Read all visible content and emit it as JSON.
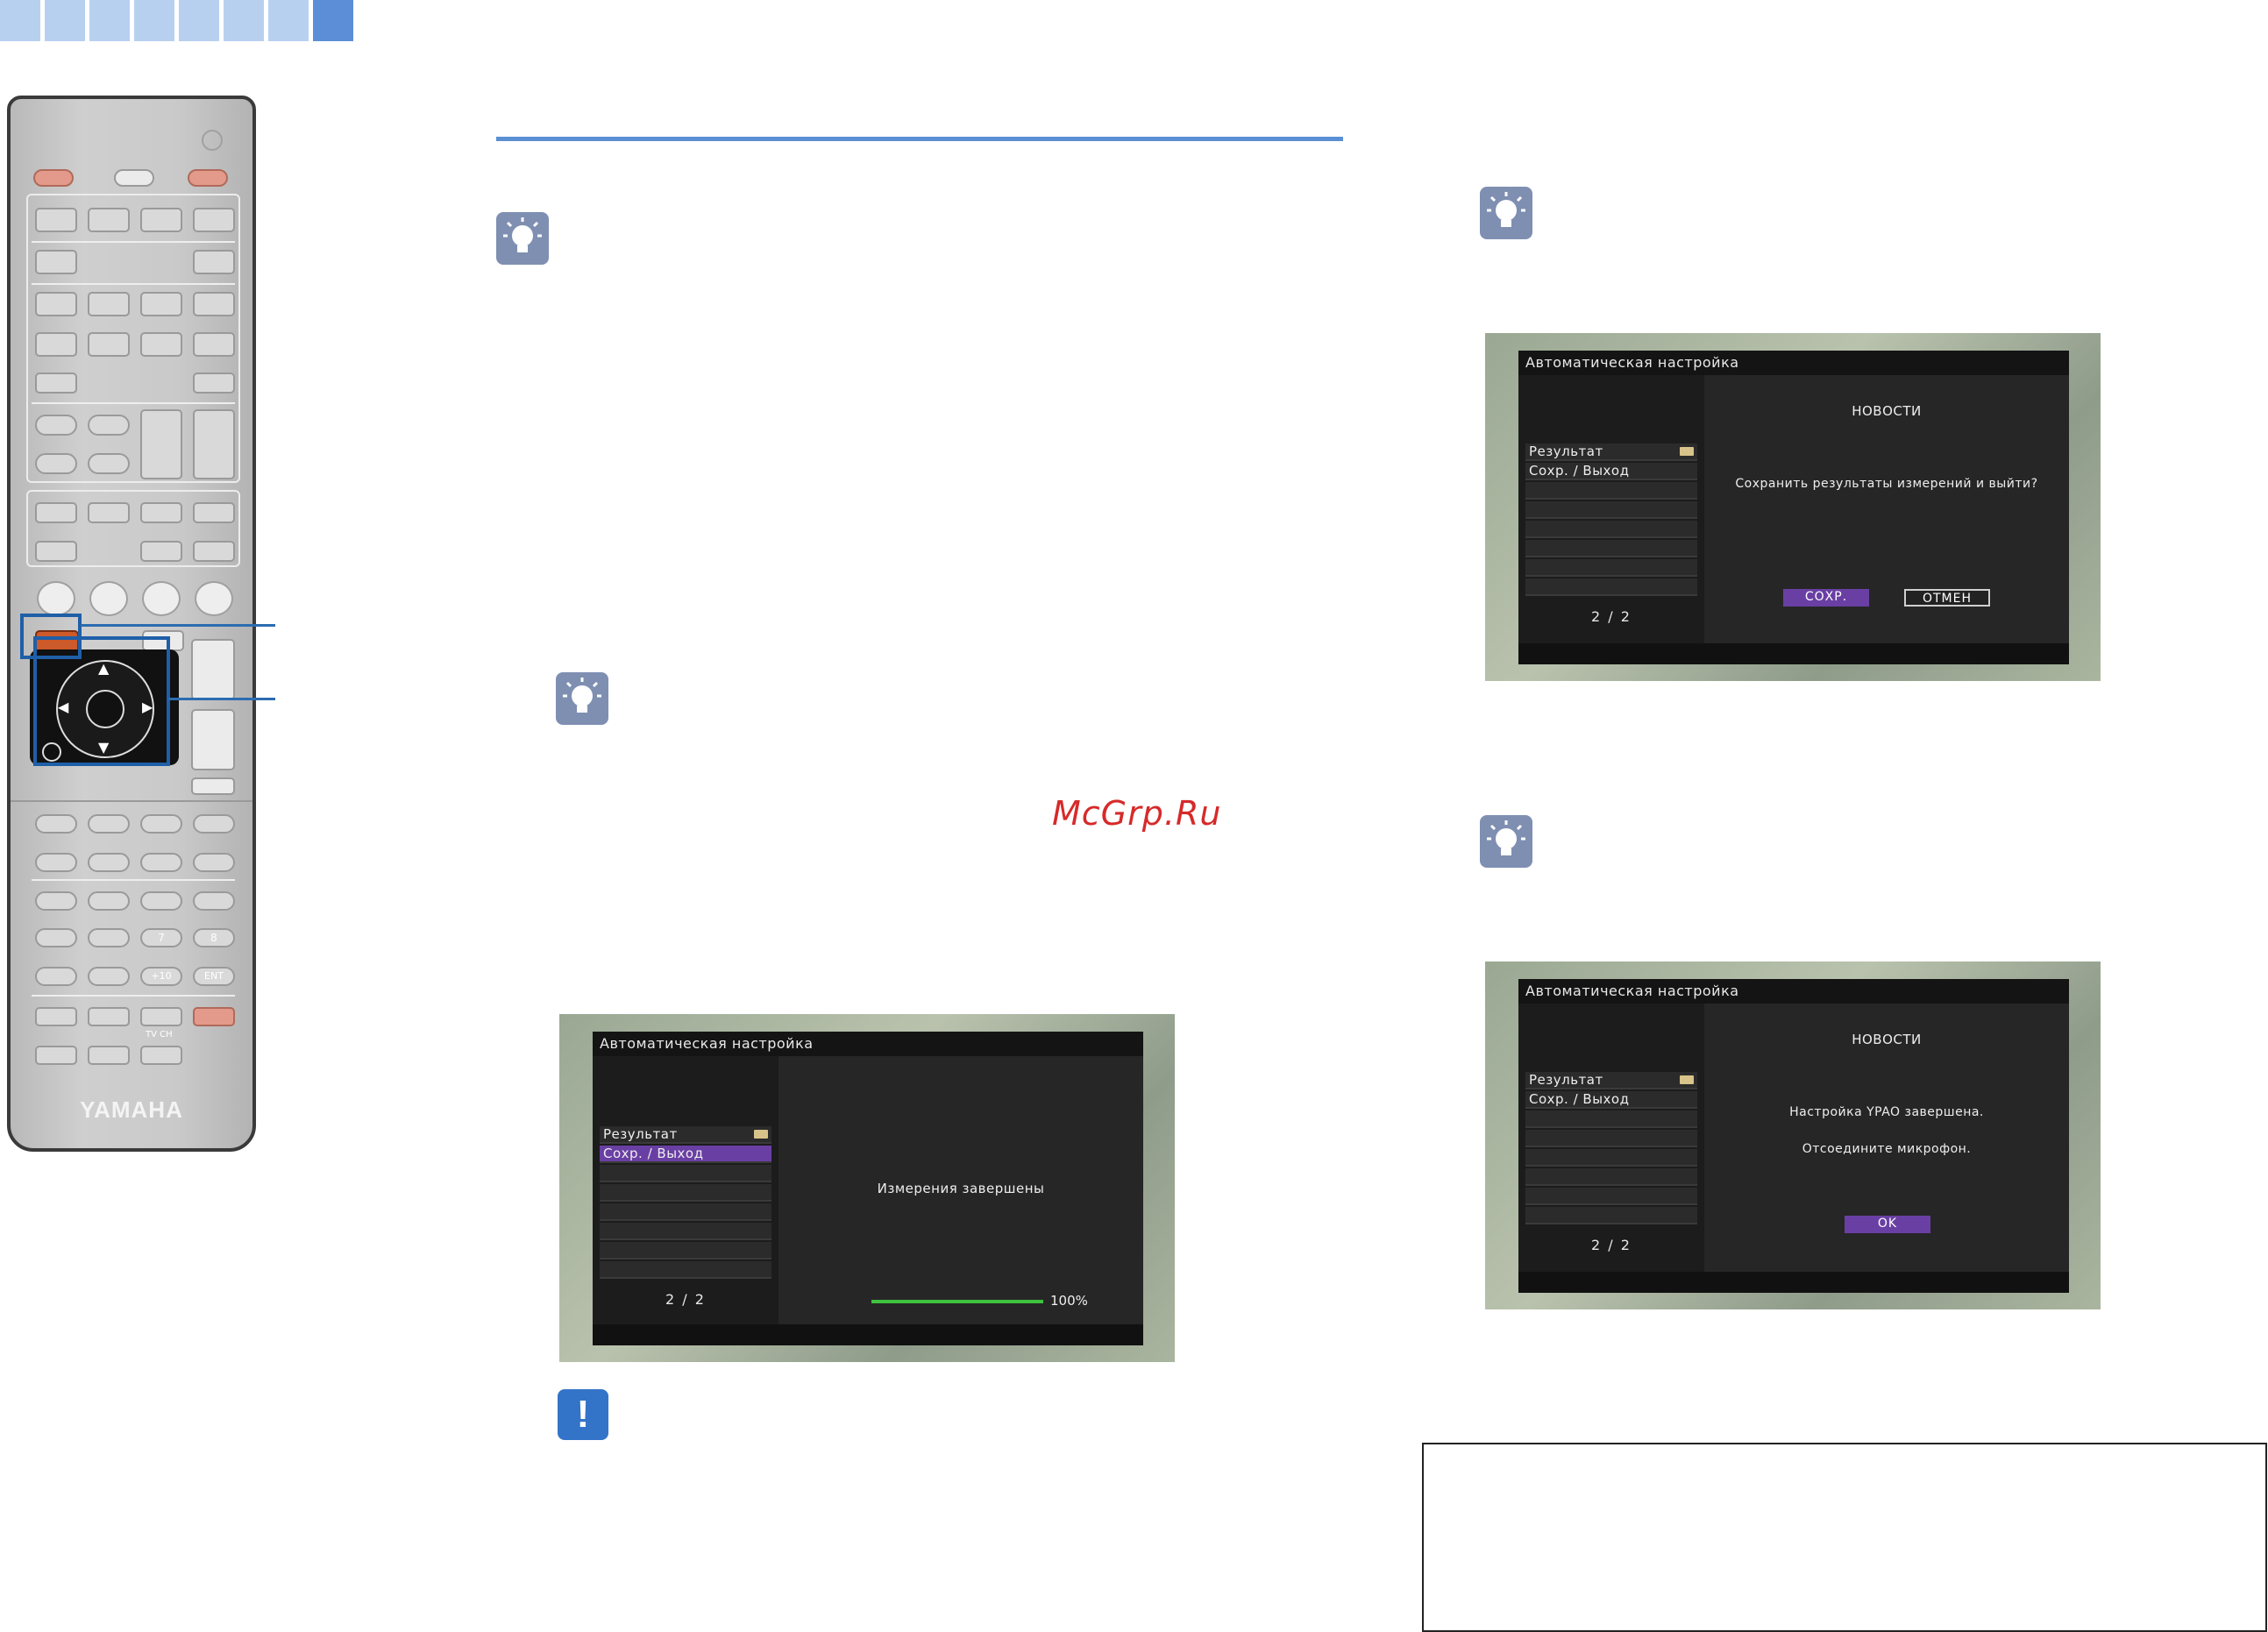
{
  "header_tabs": {
    "colors": [
      "#b8d0f0",
      "#b8d0f0",
      "#b8d0f0",
      "#b8d0f0",
      "#b8d0f0",
      "#b8d0f0",
      "#b8d0f0",
      "#5b8ed6"
    ]
  },
  "remote": {
    "brand": "YAMAHA",
    "keys": [
      "7",
      "8",
      "+10",
      "ENT",
      "TV CH"
    ]
  },
  "watermark": "McGrp.Ru",
  "screen1": {
    "title": "Автоматическая настройка",
    "menu": [
      "Результат",
      "Сохр. / Выход"
    ],
    "selected_index": 1,
    "page": "2 / 2",
    "message": "Измерения завершены",
    "progress_label": "100%",
    "progress_value": 1.0
  },
  "screen2": {
    "title": "Автоматическая настройка",
    "menu": [
      "Результат",
      "Сохр. / Выход"
    ],
    "page": "2 / 2",
    "heading": "НОВОСТИ",
    "message": "Сохранить результаты измерений и выйти?",
    "btn_save": "СОХР.",
    "btn_cancel": "ОТМЕН"
  },
  "screen3": {
    "title": "Автоматическая настройка",
    "menu": [
      "Результат",
      "Сохр. / Выход"
    ],
    "page": "2 / 2",
    "heading": "НОВОСТИ",
    "message_line1": "Настройка YPAO завершена.",
    "message_line2": "Отсоедините микрофон.",
    "btn_ok": "OK"
  },
  "colors": {
    "accent_line": "#5a8fd4",
    "callout": "#2b6cb0",
    "tip_icon": "#7f8fb2",
    "warning_icon": "#3374c8",
    "selection": "#6a3fa4",
    "progress": "#3fc23f"
  }
}
